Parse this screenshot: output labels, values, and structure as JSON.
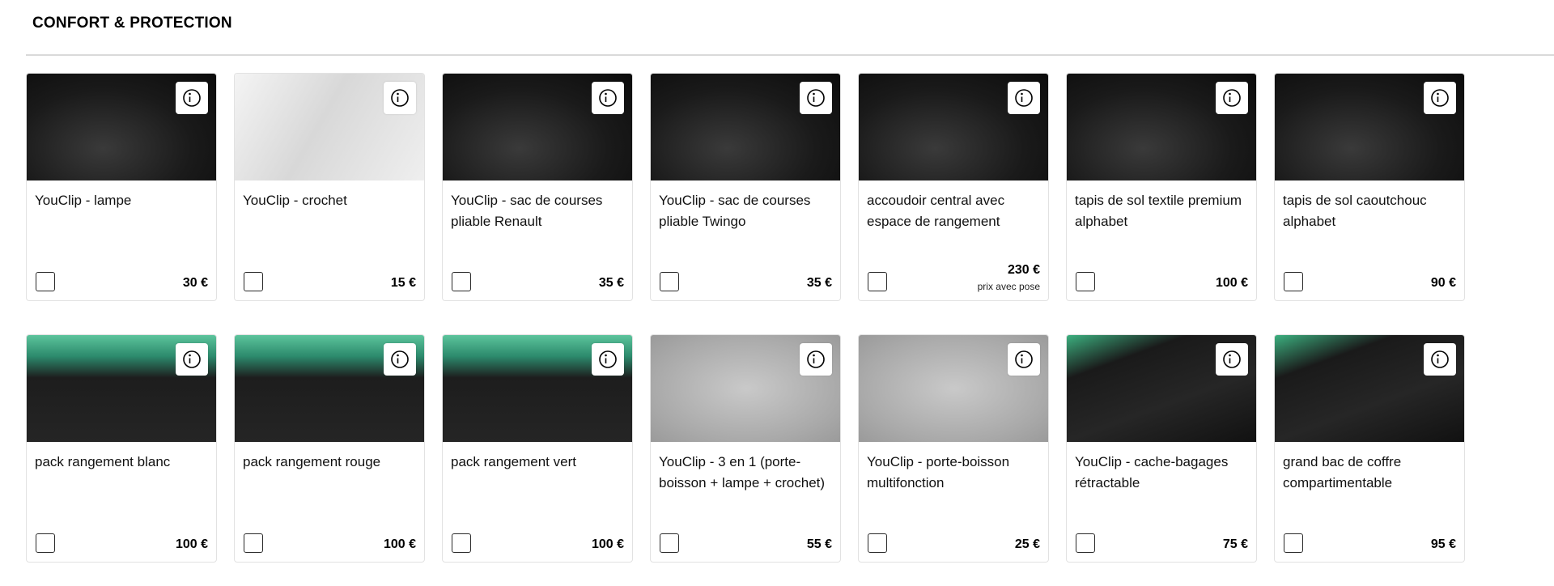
{
  "section": {
    "title": "CONFORT & PROTECTION"
  },
  "products": [
    {
      "name": "YouClip - lampe",
      "price": "30 €",
      "thumb": "dark"
    },
    {
      "name": "YouClip - crochet",
      "price": "15 €",
      "thumb": "light"
    },
    {
      "name": "YouClip - sac de courses pliable Renault",
      "price": "35 €",
      "thumb": "dark"
    },
    {
      "name": "YouClip - sac de courses pliable Twingo",
      "price": "35 €",
      "thumb": "dark"
    },
    {
      "name": "accoudoir central avec espace de rangement",
      "price": "230 €",
      "note": "prix avec pose",
      "thumb": "dark"
    },
    {
      "name": "tapis de sol textile premium alphabet",
      "price": "100 €",
      "thumb": "dark"
    },
    {
      "name": "tapis de sol caoutchouc alphabet",
      "price": "90 €",
      "thumb": "dark"
    },
    {
      "name": "pack rangement blanc",
      "price": "100 €",
      "thumb": "green"
    },
    {
      "name": "pack rangement rouge",
      "price": "100 €",
      "thumb": "green"
    },
    {
      "name": "pack rangement vert",
      "price": "100 €",
      "thumb": "green"
    },
    {
      "name": "YouClip - 3 en 1 (porte-boisson + lampe + crochet)",
      "price": "55 €",
      "thumb": "grey"
    },
    {
      "name": "YouClip - porte-boisson multifonction",
      "price": "25 €",
      "thumb": "grey"
    },
    {
      "name": "YouClip - cache-bagages rétractable",
      "price": "75 €",
      "thumb": "trunk"
    },
    {
      "name": "grand bac de coffre compartimentable",
      "price": "95 €",
      "thumb": "trunk"
    }
  ],
  "icons": {
    "info": "info-icon"
  }
}
